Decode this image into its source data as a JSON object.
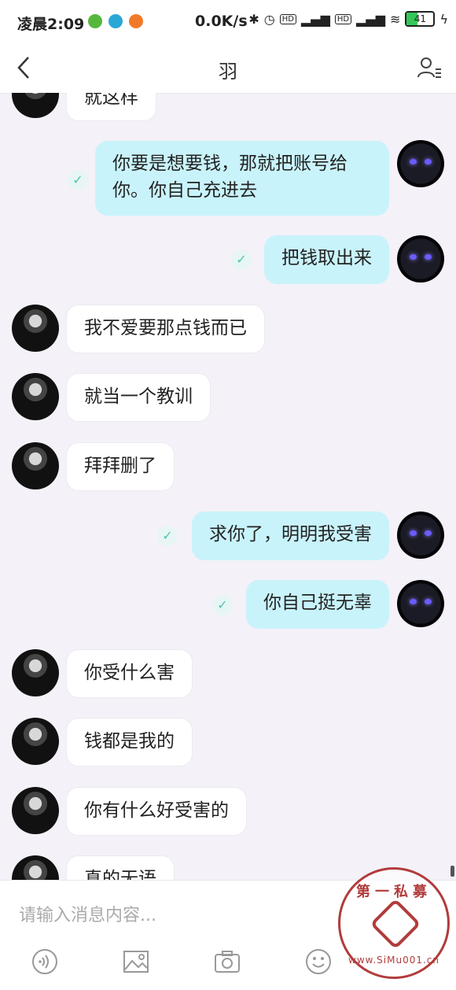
{
  "status_bar": {
    "time": "凌晨2:09",
    "speed": "0.0K/s",
    "icons": [
      "bluetooth-icon",
      "alarm-icon",
      "hd-icon",
      "signal-4g-icon",
      "hd-icon",
      "signal-4g-icon",
      "wifi-icon"
    ],
    "battery": "41",
    "battery_level": 0.41
  },
  "header": {
    "title": "羽"
  },
  "messages": [
    {
      "side": "left",
      "text": "就这样"
    },
    {
      "side": "right",
      "text": "你要是想要钱，那就把账号给你。你自己充进去"
    },
    {
      "side": "right",
      "text": "把钱取出来"
    },
    {
      "side": "left",
      "text": "我不爱要那点钱而已"
    },
    {
      "side": "left",
      "text": "就当一个教训"
    },
    {
      "side": "left",
      "text": "拜拜删了"
    },
    {
      "side": "right",
      "text": "求你了，明明我受害"
    },
    {
      "side": "right",
      "text": "你自己挺无辜"
    },
    {
      "side": "left",
      "text": "你受什么害"
    },
    {
      "side": "left",
      "text": "钱都是我的"
    },
    {
      "side": "left",
      "text": "你有什么好受害的"
    },
    {
      "side": "left",
      "text": "真的无语"
    }
  ],
  "input": {
    "placeholder": "请输入消息内容..."
  },
  "toolbar": [
    "voice-icon",
    "image-icon",
    "camera-icon",
    "emoji-icon"
  ],
  "watermark": {
    "top": "第一私募",
    "bottom": "www.SiMu001.cn"
  },
  "colors": {
    "right_bubble": "#c9f3fb",
    "left_bubble": "#ffffff",
    "check": "#4fc3b5",
    "background": "#f4f1f8"
  }
}
